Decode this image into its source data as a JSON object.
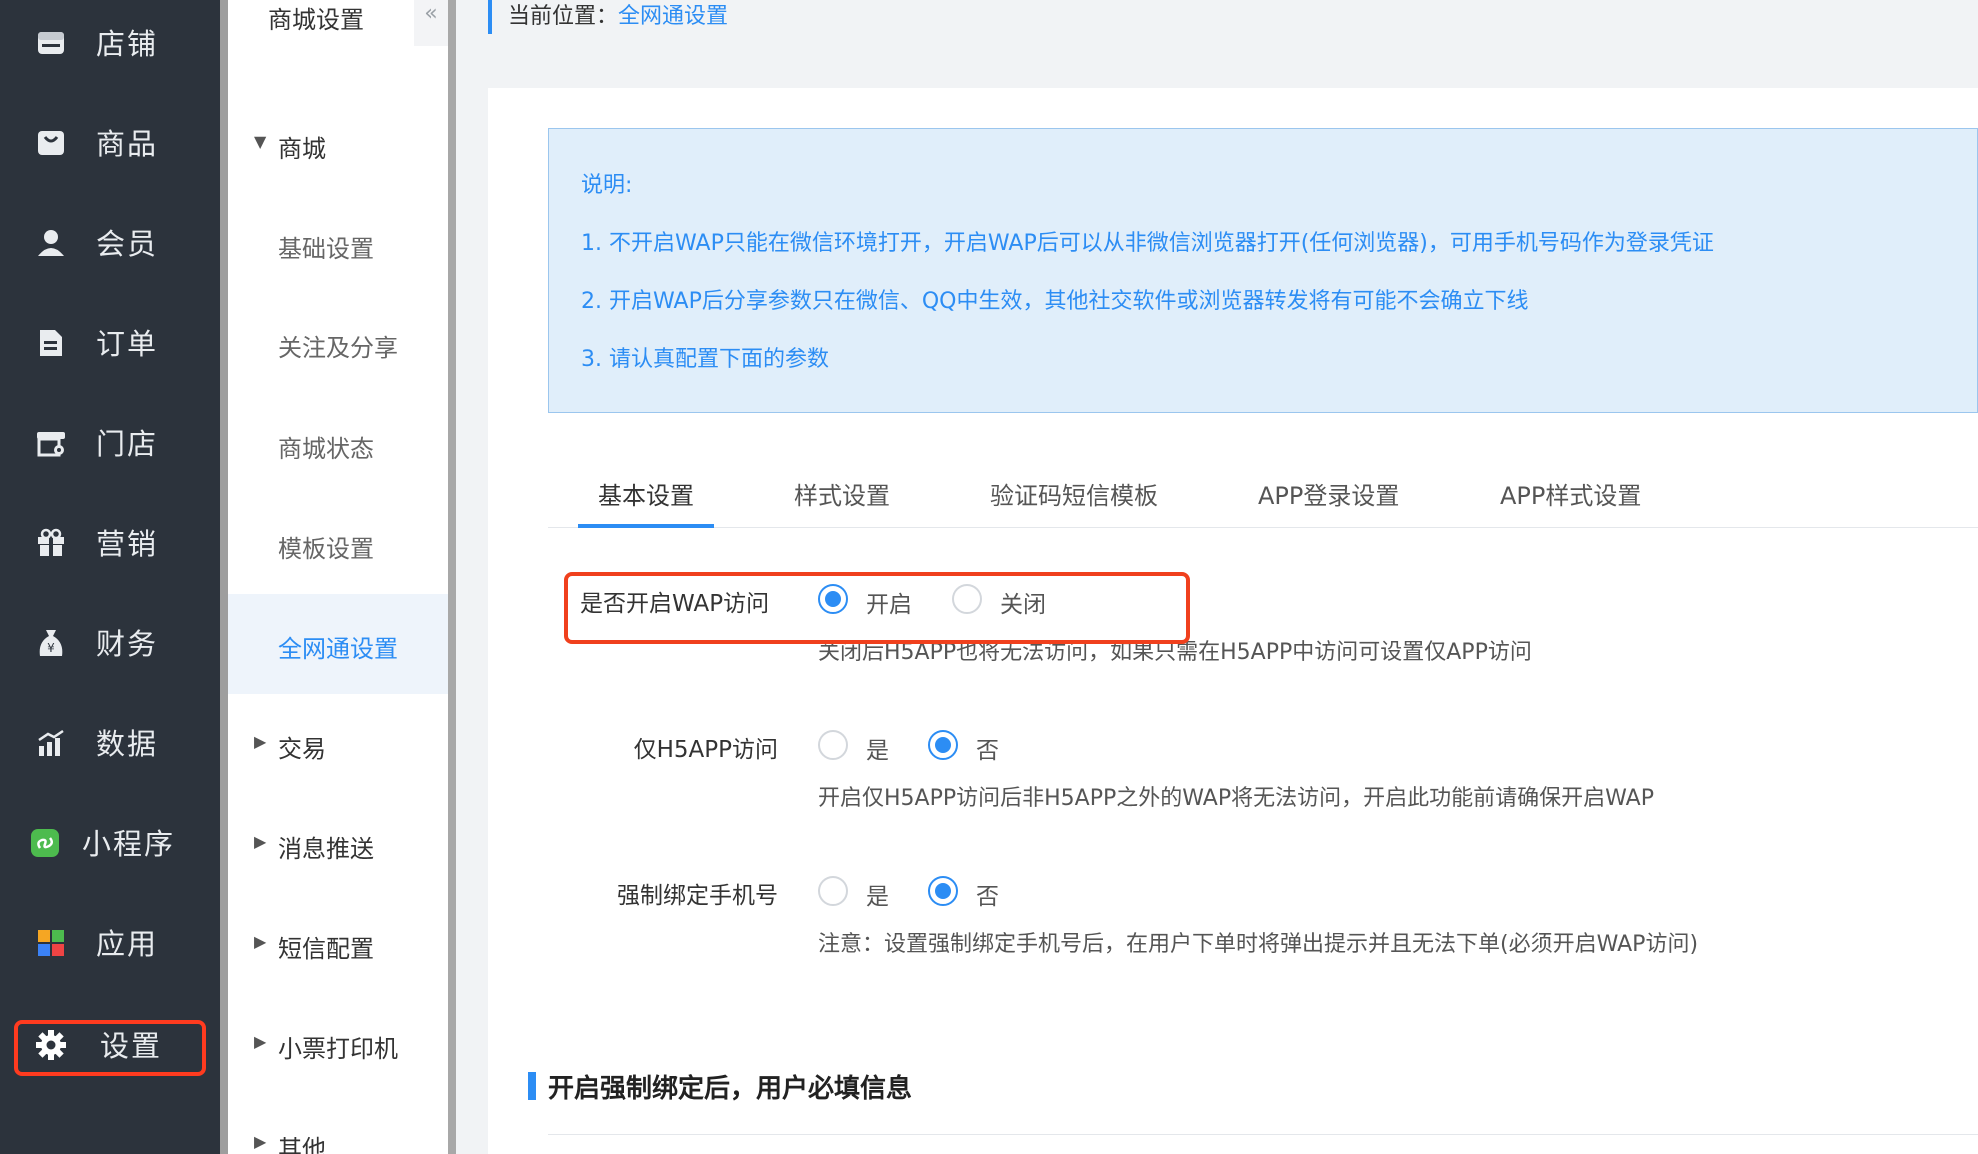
{
  "main_nav": {
    "items": [
      {
        "label": "店铺",
        "icon": "store-icon"
      },
      {
        "label": "商品",
        "icon": "bag-icon"
      },
      {
        "label": "会员",
        "icon": "user-icon"
      },
      {
        "label": "订单",
        "icon": "document-icon"
      },
      {
        "label": "门店",
        "icon": "shop-settings-icon"
      },
      {
        "label": "营销",
        "icon": "gift-icon"
      },
      {
        "label": "财务",
        "icon": "money-bag-icon"
      },
      {
        "label": "数据",
        "icon": "chart-icon"
      },
      {
        "label": "小程序",
        "icon": "mini-program-icon"
      },
      {
        "label": "应用",
        "icon": "apps-icon"
      },
      {
        "label": "设置",
        "icon": "gear-icon"
      }
    ]
  },
  "sub_nav": {
    "title": "商城设置",
    "collapse_glyph": "«",
    "group_open": "商城",
    "children": [
      "基础设置",
      "关注及分享",
      "商城状态",
      "模板设置",
      "全网通设置"
    ],
    "active": "全网通设置",
    "groups": [
      "交易",
      "消息推送",
      "短信配置",
      "小票打印机",
      "其他"
    ]
  },
  "breadcrumb": {
    "prefix": "当前位置：",
    "current": "全网通设置"
  },
  "notice": {
    "heading": "说明:",
    "lines": [
      "1. 不开启WAP只能在微信环境打开，开启WAP后可以从非微信浏览器打开(任何浏览器)，可用手机号码作为登录凭证",
      "2. 开启WAP后分享参数只在微信、QQ中生效，其他社交软件或浏览器转发将有可能不会确立下线",
      "3. 请认真配置下面的参数"
    ]
  },
  "tabs": [
    "基本设置",
    "样式设置",
    "验证码短信模板",
    "APP登录设置",
    "APP样式设置"
  ],
  "form": {
    "wap": {
      "label": "是否开启WAP访问",
      "opt_on": "开启",
      "opt_off": "关闭",
      "selected": "开启",
      "help": "关闭后H5APP也将无法访问，如果只需在H5APP中访问可设置仅APP访问"
    },
    "h5only": {
      "label": "仅H5APP访问",
      "opt_yes": "是",
      "opt_no": "否",
      "selected": "否",
      "help": "开启仅H5APP访问后非H5APP之外的WAP将无法访问，开启此功能前请确保开启WAP"
    },
    "bindphone": {
      "label": "强制绑定手机号",
      "opt_yes": "是",
      "opt_no": "否",
      "selected": "否",
      "help": "注意：设置强制绑定手机号后，在用户下单时将弹出提示并且无法下单(必须开启WAP访问)"
    }
  },
  "section": {
    "title": "开启强制绑定后，用户必填信息"
  },
  "colors": {
    "accent": "#2c8df4",
    "sidebar": "#2c333c",
    "highlight": "#f0401d"
  }
}
